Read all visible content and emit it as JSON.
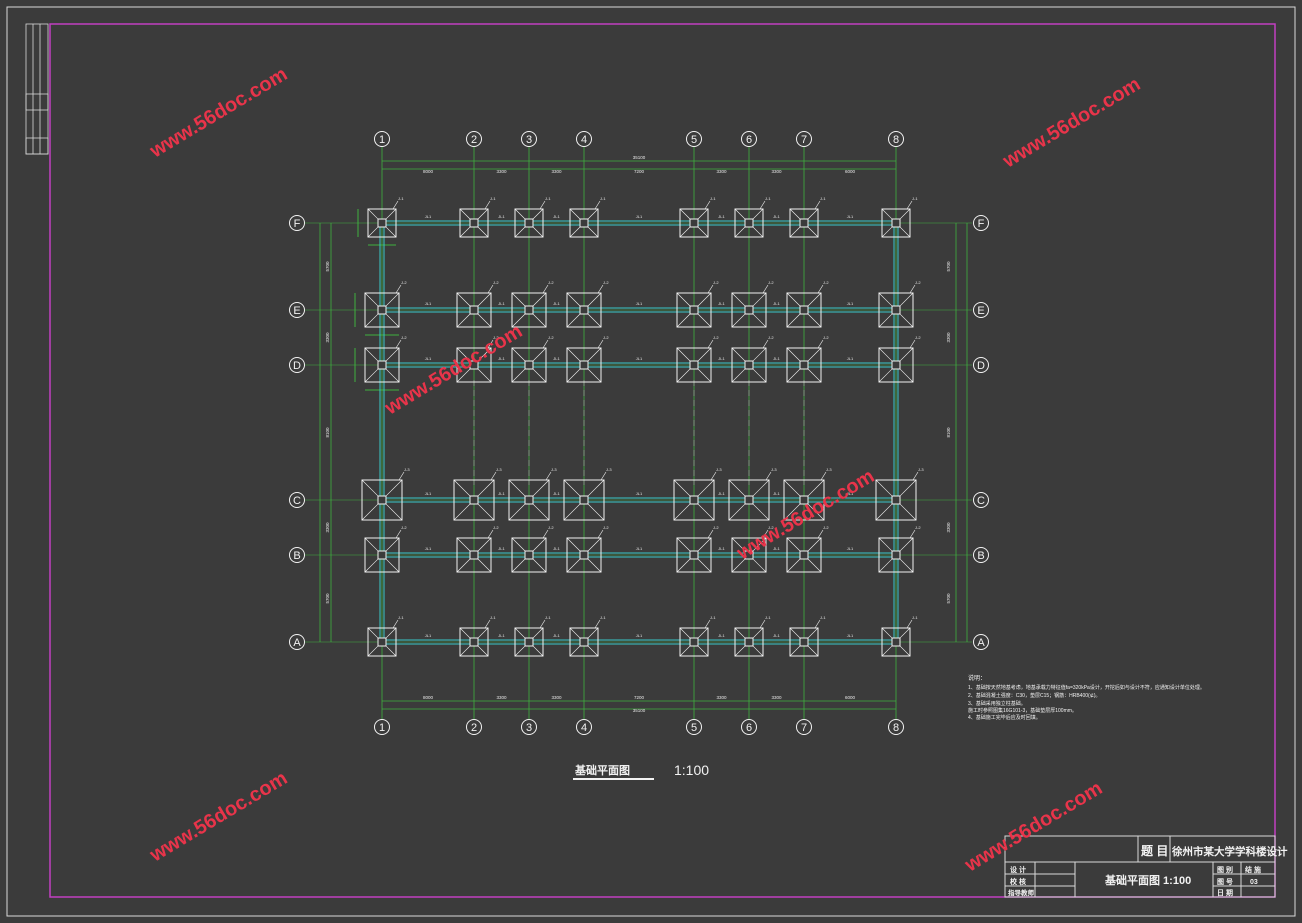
{
  "title_block": {
    "label_project": "题 目",
    "project_name": "徐州市某大学学科楼设计",
    "drawing_name": "基础平面图 1:100",
    "left_rows": [
      "设 计",
      "校 核",
      "指导教师"
    ],
    "right_rows": [
      {
        "label": "图 别",
        "value": "结 施"
      },
      {
        "label": "图 号",
        "value": "03"
      },
      {
        "label": "日 期",
        "value": ""
      }
    ]
  },
  "drawing": {
    "plan_title": "基础平面图",
    "scale": "1:100",
    "column_axes": [
      "1",
      "2",
      "3",
      "4",
      "5",
      "6",
      "7",
      "8"
    ],
    "row_axes": [
      "F",
      "E",
      "D",
      "C",
      "B",
      "A"
    ],
    "column_spacings": [
      "8000",
      "3300",
      "3300",
      "7200",
      "3300",
      "3300",
      "6000"
    ],
    "total_width": "35100",
    "row_spacings": [
      "5700",
      "3300",
      "8100",
      "3300",
      "5700"
    ],
    "footing_labels": [
      "J-1",
      "J-2",
      "J-3"
    ],
    "beam_label": "JL1"
  },
  "notes": {
    "heading": "说明：",
    "lines": [
      "1、基础按天然地基考虑，地基承载力特征值fa=320kPa设计，开挖后如与设计不符，应通知设计单位处理。",
      "2、基础混凝土强度：C30，垫层C15；钢筋：HRB400(⊈)。",
      "3、基础采用独立柱基础。",
      "   施工时参照图集16G101-3，基础垫层厚100mm。",
      "4、基础施工完毕后应及时回填。"
    ]
  },
  "watermark": "www.56doc.com",
  "colors": {
    "background": "#3b3b3b",
    "frame": "#c23fc2",
    "axis_dim": "#3fb23f",
    "beam": "#38c8c8",
    "footing": "#f2f2f2",
    "watermark": "#e8344a"
  }
}
